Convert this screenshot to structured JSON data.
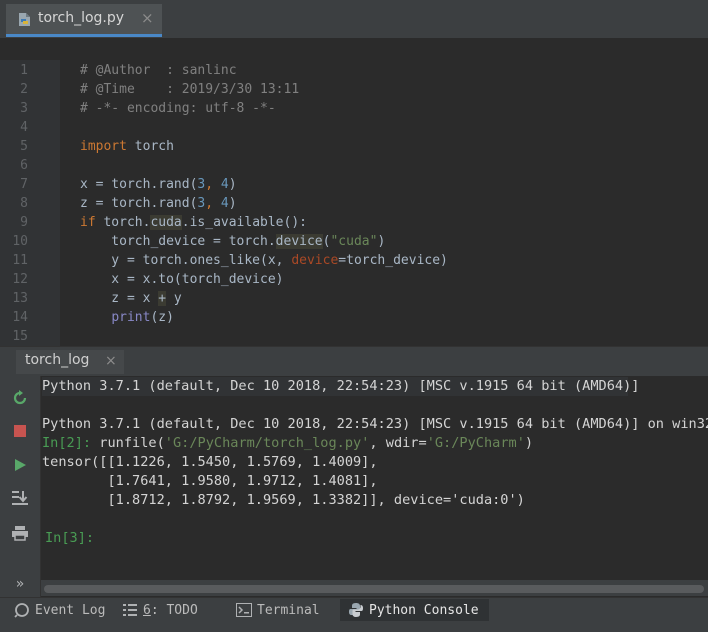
{
  "editor_tab": {
    "filename": "torch_log.py",
    "close_glyph": "×",
    "icon": "python-file-icon"
  },
  "line_numbers": [
    "1",
    "2",
    "3",
    "4",
    "5",
    "6",
    "7",
    "8",
    "9",
    "10",
    "11",
    "12",
    "13",
    "14",
    "15"
  ],
  "code_tokens": {
    "l1_comment": "# @Author  : sanlinc",
    "l2_comment": "# @Time    : 2019/3/30 13:11",
    "l3_comment": "# -*- encoding: utf-8 -*-",
    "l5_import": "import",
    "l5_module": " torch",
    "l7_a": "x = torch.rand(",
    "l7_n1": "3",
    "l7_b": ", ",
    "l7_n2": "4",
    "l7_c": ")",
    "l8_a": "z = torch.rand(",
    "l8_n1": "3",
    "l8_b": ", ",
    "l8_n2": "4",
    "l8_c": ")",
    "l9_if": "if",
    "l9_a": " torch.",
    "l9_cuda": "cuda",
    "l9_b": ".is_available():",
    "l10_a": "    torch_device = torch.",
    "l10_device": "device",
    "l10_b": "(",
    "l10_str": "\"cuda\"",
    "l10_c": ")",
    "l11_a": "    y = torch.ones_like(x, ",
    "l11_param": "device",
    "l11_b": "=torch_device)",
    "l12": "    x = x.to(torch_device)",
    "l13_a": "    z = x ",
    "l13_plus": "+",
    "l13_b": " y",
    "l14_indent": "    ",
    "l14_print": "print",
    "l14_b": "(z)"
  },
  "console_tab": {
    "label": "torch_log",
    "close_glyph": "×"
  },
  "console_tools": [
    "rerun-icon",
    "stop-icon",
    "run-icon",
    "scroll-to-end-icon",
    "print-icon",
    "more-icon"
  ],
  "console": {
    "banner": "Python 3.7.1 (default, Dec 10 2018, 22:54:23) [MSC v.1915 64 bit (AMD64)]",
    "version_line": "Python 3.7.1 (default, Dec 10 2018, 22:54:23) [MSC v.1915 64 bit (AMD64)] on win32",
    "in2_prompt": "In[2]:",
    "in2_cmd_a": " runfile(",
    "in2_str1": "'G:/PyCharm/torch_log.py'",
    "in2_cmd_b": ", wdir=",
    "in2_str2": "'G:/PyCharm'",
    "in2_cmd_c": ")",
    "out1": "tensor([[1.1226, 1.5450, 1.5769, 1.4009],",
    "out2": "        [1.7641, 1.9580, 1.9712, 1.4081],",
    "out3": "        [1.8712, 1.8792, 1.9569, 1.3382]], device='cuda:0')",
    "in3_prompt": "In[3]:"
  },
  "bottom_tabs": {
    "event_log": "Event Log",
    "todo_num": "6",
    "todo_rest": ": TODO",
    "terminal": "Terminal",
    "python_console": "Python Console"
  },
  "colors": {
    "background": "#2b2b2b",
    "keyword": "#cc7832",
    "number": "#6897bb",
    "string": "#6a8759",
    "comment": "#808080",
    "prompt": "#499c54",
    "tab_underline": "#4a88c7"
  }
}
